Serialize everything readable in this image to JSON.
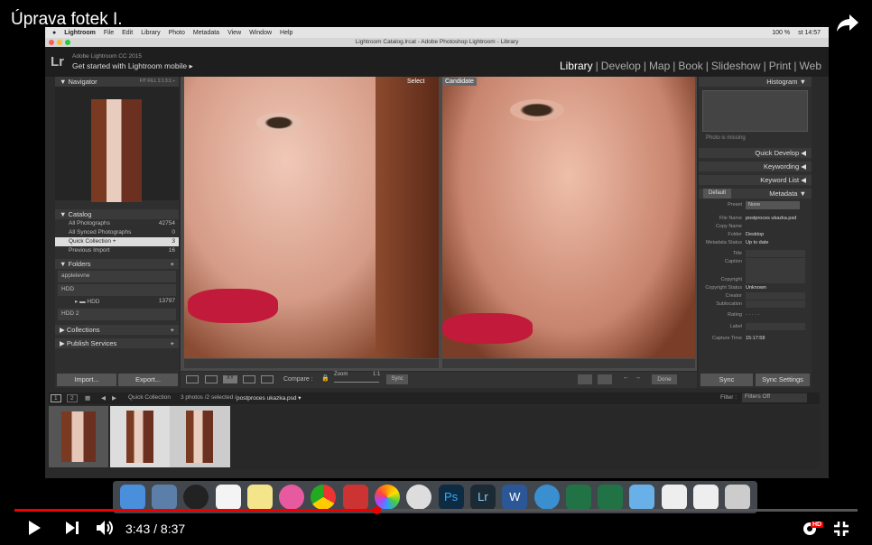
{
  "video": {
    "title": "Úprava fotek I.",
    "current_time": "3:43",
    "duration": "8:37",
    "time_display": "3:43 / 8:37",
    "progress_fraction": 0.43,
    "quality_badge": "HD"
  },
  "mac_menu": {
    "items": [
      "Lightroom",
      "File",
      "Edit",
      "Library",
      "Photo",
      "Metadata",
      "View",
      "Window",
      "Help"
    ],
    "battery": "100 %",
    "clock": "st 14:57"
  },
  "window": {
    "title": "Lightroom Catalog.lrcat - Adobe Photoshop Lightroom - Library"
  },
  "lr": {
    "logo": "Lr",
    "version": "Adobe Lightroom CC 2015",
    "mobile": "Get started with Lightroom mobile ▸",
    "modules": [
      "Library",
      "|",
      "Develop",
      "|",
      "Map",
      "|",
      "Book",
      "|",
      "Slideshow",
      "|",
      "Print",
      "|",
      "Web"
    ],
    "active_module": "Library"
  },
  "left": {
    "navigator": "Navigator",
    "nav_modes": "FIT  FILL  1:1  3:1 ÷",
    "catalog": "Catalog",
    "catalog_items": [
      {
        "label": "All Photographs",
        "count": "42754"
      },
      {
        "label": "All Synced Photographs",
        "count": "0"
      },
      {
        "label": "Quick Collection +",
        "count": "3"
      },
      {
        "label": "Previous Import",
        "count": "16"
      }
    ],
    "folders": "Folders",
    "folder_items": [
      {
        "label": "applelevne",
        "count": ""
      },
      {
        "label": "HDD",
        "count": ""
      },
      {
        "label": "HDD",
        "count": "13797"
      },
      {
        "label": "HDD 2",
        "count": ""
      }
    ],
    "collections": "Collections",
    "publish": "Publish Services",
    "import": "Import...",
    "export": "Export..."
  },
  "compare": {
    "select_label": "Select",
    "candidate_label": "Candidate",
    "compare_label": "Compare :",
    "zoom_label": "Zoom",
    "zoom_value": "1:1",
    "sync": "Sync",
    "done": "Done"
  },
  "right": {
    "histogram": "Histogram",
    "photo_missing": "Photo is missing",
    "quick_develop": "Quick Develop",
    "keywording": "Keywording",
    "keyword_list": "Keyword List",
    "metadata": "Metadata",
    "default": "Default",
    "fields": [
      {
        "label": "Preset",
        "value": "None"
      },
      {
        "label": "File Name",
        "value": "postproces ukazka.psd"
      },
      {
        "label": "Copy Name",
        "value": ""
      },
      {
        "label": "Folder",
        "value": "Desktop"
      },
      {
        "label": "Metadata Status",
        "value": "Up to date"
      },
      {
        "label": "Title",
        "value": ""
      },
      {
        "label": "Caption",
        "value": ""
      },
      {
        "label": "Copyright",
        "value": ""
      },
      {
        "label": "Copyright Status",
        "value": "Unknown"
      },
      {
        "label": "Creator",
        "value": ""
      },
      {
        "label": "Sublocation",
        "value": ""
      },
      {
        "label": "Rating",
        "value": "· · · · ·"
      },
      {
        "label": "Label",
        "value": ""
      },
      {
        "label": "Capture Time",
        "value": "15:17:58"
      }
    ],
    "sync": "Sync",
    "sync_settings": "Sync Settings"
  },
  "filmstrip": {
    "source": "Quick Collection",
    "info": "3 photos /2 selected /",
    "file": "postproces ukazka.psd ▾",
    "filter_label": "Filter :",
    "filter_value": "Filters Off",
    "pages": [
      "1",
      "2"
    ]
  },
  "colors": {
    "accent": "#e00000",
    "lr_bg": "#2a2a2a"
  }
}
